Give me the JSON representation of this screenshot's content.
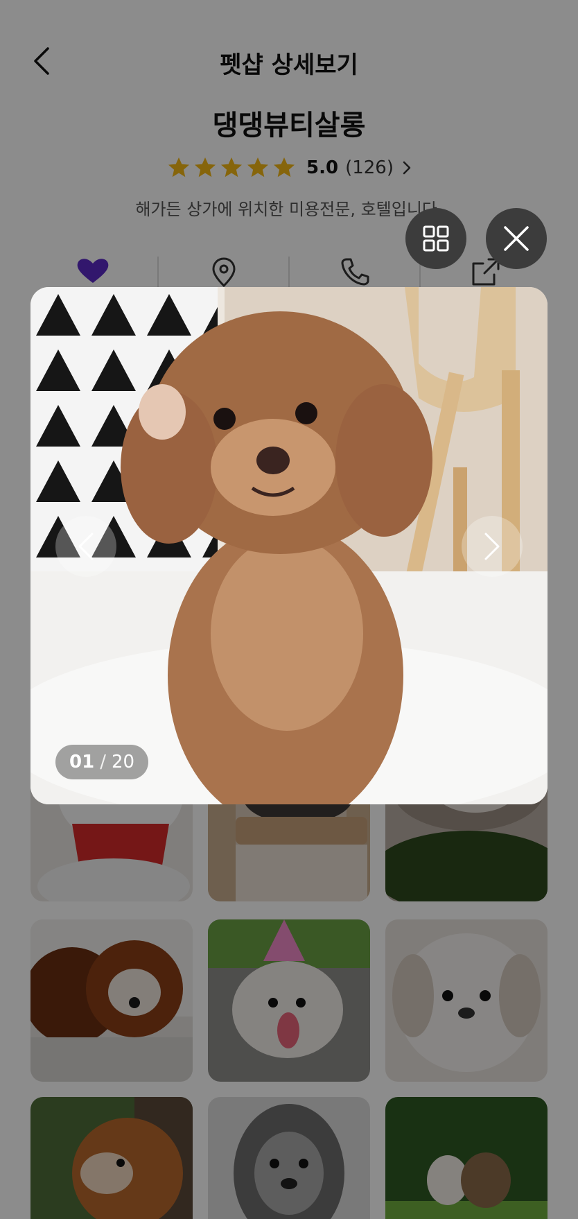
{
  "header": {
    "title": "펫샵 상세보기",
    "back_icon": "chevron-left-icon"
  },
  "shop": {
    "name": "댕댕뷰티살롱",
    "rating": "5.0",
    "review_count": "(126)",
    "description": "해가든 상가에 위치한 미용전문, 호텔입니다.",
    "star_count": 5,
    "star_color": "#f5b915"
  },
  "actions": [
    {
      "icon": "heart-icon",
      "color": "#5b2bc7"
    },
    {
      "icon": "location-pin-icon",
      "color": "#333333"
    },
    {
      "icon": "phone-icon",
      "color": "#333333"
    },
    {
      "icon": "share-icon",
      "color": "#333333"
    }
  ],
  "viewer": {
    "current": "01",
    "separator": "/",
    "total": "20",
    "grid_icon": "grid-icon",
    "close_icon": "close-icon",
    "prev_icon": "chevron-left-icon",
    "next_icon": "chevron-right-icon"
  },
  "colors": {
    "overlay": "#000000",
    "accent_purple": "#5b2bc7"
  }
}
